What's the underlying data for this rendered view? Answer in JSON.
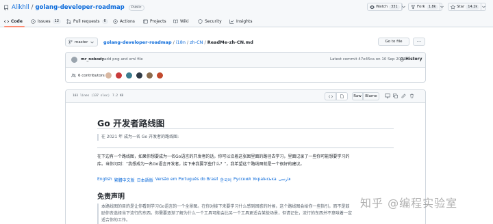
{
  "repo": {
    "owner": "Alikhll",
    "separator": "/",
    "name": "golang-developer-roadmap",
    "visibility": "Public"
  },
  "header_actions": {
    "watch": {
      "label": "Watch",
      "count": "331"
    },
    "fork": {
      "label": "Fork",
      "count": "1.8k"
    },
    "star": {
      "label": "Star",
      "count": "14.2k"
    }
  },
  "tabs": [
    {
      "label": "Code",
      "count": ""
    },
    {
      "label": "Issues",
      "count": "12"
    },
    {
      "label": "Pull requests",
      "count": "6"
    },
    {
      "label": "Actions",
      "count": ""
    },
    {
      "label": "Projects",
      "count": ""
    },
    {
      "label": "Wiki",
      "count": ""
    },
    {
      "label": "Security",
      "count": ""
    },
    {
      "label": "Insights",
      "count": ""
    }
  ],
  "file_nav": {
    "branch": "master",
    "crumbs": [
      "golang-developer-roadmap",
      "i18n",
      "zh-CN"
    ],
    "crumb_sep": "/",
    "current_file": "ReadMe-zh-CN.md",
    "goto_file_label": "Go to file",
    "more_label": "···"
  },
  "commit": {
    "author": "mr_nobody",
    "message": "add png and xml file",
    "latest_label": "Latest commit 47e45ca on 10 Sep 2021",
    "history_label": "History",
    "contributors_label": "6 contributors"
  },
  "file_toolbar": {
    "lines_label": "103 lines (137 sloc)",
    "size_label": "7.2 KB",
    "raw_label": "Raw",
    "blame_label": "Blame"
  },
  "markdown": {
    "title": "Go 开发者路线图",
    "subtitle_quote": "在 2021 年 成为一名 Go 开发者的路线图:",
    "intro_line1": "在下边有一个路线图，如果你想要成为一名Go语言的开发者的话，你可以沿着这张图里面的路径去学习，里面记录了一些你可能想要学习的",
    "intro_line2": "库。当你问到：“我想成为一名Go语言开发者，接下来我要学些什么？”，我希望这个路线图就是一个很好的建议。",
    "languages": [
      "English",
      "繁體中文版",
      "日本語版",
      "Versão em Português do Brasil",
      "한국어",
      "Русский",
      "Українська",
      "فارسی"
    ],
    "disclaimer_heading": "免责声明",
    "disclaimer_line1": "本路线图的目的是让你看到学习Go语言的一个全景图。在你对接下来要学习什么感到困惑的时候，这个路线图会给你一些指引，而不是鼓",
    "disclaimer_line2": "励你去选择当下流行的东西。你需要逐渐了解为什么一个工具可能会比另一个工具更适合某些场景，但请记住，流行的东西并不意味着一定",
    "disclaimer_line3": "适合你的工作。"
  },
  "watermark": "知乎 @编程实验室",
  "colors": {
    "link": "#0969da",
    "header_bg": "#f6f8fa",
    "border": "#d0d7de",
    "active_tab": "#fd8c73"
  }
}
